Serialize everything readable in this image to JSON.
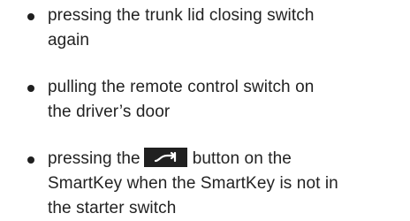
{
  "items": [
    {
      "lines": [
        "pressing the trunk lid closing switch",
        "again"
      ]
    },
    {
      "lines": [
        "pulling the remote control switch on",
        "the driver’s door"
      ]
    },
    {
      "lines": [
        "pressing the",
        "button on the",
        "SmartKey when the SmartKey is not in",
        "the starter switch"
      ],
      "icon": "trunk-lid-button-icon"
    }
  ]
}
